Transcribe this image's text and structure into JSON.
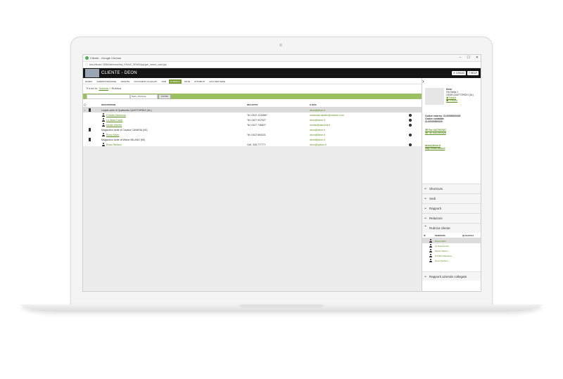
{
  "browser": {
    "window_title": "Cliente - Google Chrome",
    "url": "test-eltools?-8080/kehmonihtly_FMAIZ_DEMO/jsp/gdr_ricevrt_card.jsp"
  },
  "app": {
    "title": "CLIENTE - DEON",
    "close_label": "CHIUDI",
    "help_label": "HELP"
  },
  "tabs": [
    "DIARIO",
    "AMMINISTRAZIONE",
    "VENDITE",
    "DOCUMENTI ALLEGATI",
    "CRM",
    "RUBRICA",
    "NOTE",
    "ATTRIBUTI",
    "DATI PER SEDE"
  ],
  "active_tab": "RUBRICA",
  "breadcrumb": {
    "prefix": "Ti trovi in:",
    "link": "Scheda",
    "sep": ">",
    "current": "Rubrica"
  },
  "filter": {
    "select_value": "Sedi + Persone",
    "button_label": "FILTRA"
  },
  "table": {
    "headers": {
      "description": "DESCRIZIONE",
      "phone": "RECAPITO",
      "email": "E-MAIL"
    },
    "rows": [
      {
        "type": "site",
        "desc": "Legale sede di Quattordio QUATTORDIO (AL)",
        "phone": "",
        "email": "deon@deon.it",
        "info": false
      },
      {
        "type": "person",
        "desc": "D'Addio Marianna",
        "phone": "Tel. 0422 1234567",
        "email": "marianna.daddio@nowere.com",
        "info": true
      },
      {
        "type": "person",
        "desc": "La Nasa Guido",
        "phone": "Tel. 0427 937927",
        "email": "deon@deon.it",
        "info": true
      },
      {
        "type": "person",
        "desc": "Medici Alberto",
        "phone": "Tel. 0427 736827",
        "email": "medici@dacorda.it",
        "info": true
      },
      {
        "type": "site",
        "desc": "Magazzino sede di Cavaria CAVARIA (VA)",
        "phone": "",
        "email": "deon@deon.it",
        "info": false
      },
      {
        "type": "person",
        "desc": "Rossi Mario",
        "phone": "Tel. 0422 654321",
        "email": "deon@deon.it",
        "info": true
      },
      {
        "type": "site",
        "desc": "Magazzino sede di Milano MILANO (MI)",
        "phone": "",
        "email": "deon@deon.it",
        "info": false
      },
      {
        "type": "person",
        "desc": "Rossi Stefano",
        "phone": "Cell. 328 777777",
        "email": "deon@yahoo.it",
        "info": true
      }
    ]
  },
  "card": {
    "name": "Deon",
    "address1": "Via Santa 1",
    "address2": "15028 QUATTORDIO (AL)",
    "link1": "Mappa",
    "link2": "Persone",
    "code1": "Codice esterno: CL00000000029",
    "code2": "Codice contabile:",
    "code3": "CL00000000029",
    "fax": "Fax 0427937927",
    "tel": "Tel. 0427937928",
    "email": "deon@deon.it",
    "web": "http://www.deon.it"
  },
  "sections": {
    "shortcuts": "Shortcuts",
    "sedi": "Sedi",
    "rapporti": "Rapporti",
    "relazioni": "Relazioni",
    "rubrica": "Rubrica cliente",
    "aziende": "Rapporti aziende collegate"
  },
  "rubrica_panel": {
    "col1": "PERSONA",
    "col2": "QUALIFICA",
    "people": [
      "Rossi Mario",
      "La Nasa Guido",
      "Medici Alberto",
      "D'Addio Marianna",
      "Rossi Stefano"
    ]
  }
}
